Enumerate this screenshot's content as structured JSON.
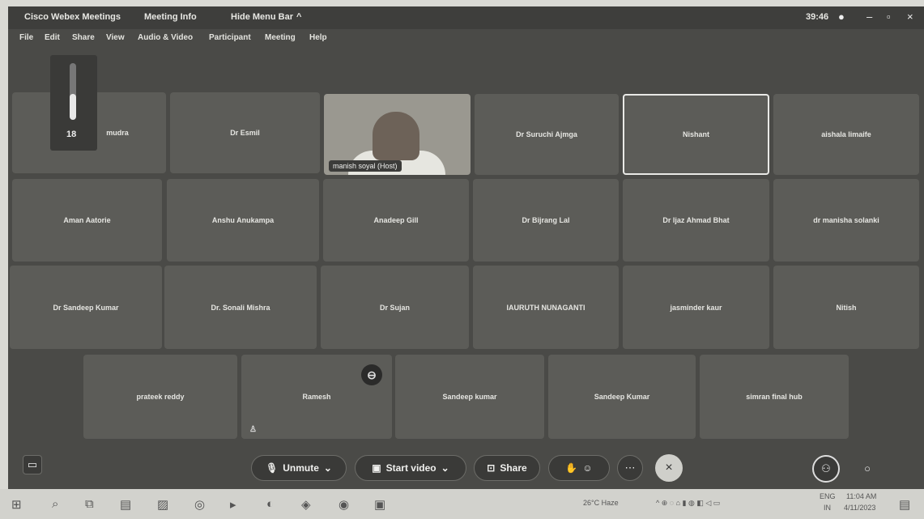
{
  "titlebar": {
    "app_name": "Cisco Webex Meetings",
    "meeting_info": "Meeting Info",
    "hide_menu": "Hide Menu Bar",
    "clock": "39:46"
  },
  "menu": [
    "File",
    "Edit",
    "Share",
    "View",
    "Audio & Video",
    "Participant",
    "Meeting",
    "Help"
  ],
  "volume": {
    "value": "18",
    "level": 0.45
  },
  "tiles_row1": [
    "mudra",
    "Dr Esmil",
    "manish soyal (Host)",
    "Dr Suruchi Ajmga",
    "Nishant",
    "aishala limaife"
  ],
  "tiles_row2": [
    "Aman Aatorie",
    "Anshu Anukampa",
    "Anadeep Gill",
    "Dr Bijrang Lal",
    "Dr Ijaz Ahmad Bhat",
    "dr manisha solanki"
  ],
  "tiles_row3": [
    "Dr Sandeep Kumar",
    "Dr. Sonali Mishra",
    "Dr Sujan",
    "IAURUTH NUNAGANTI",
    "jasminder kaur",
    "Nitish"
  ],
  "tiles_row4": [
    "prateek reddy",
    "Ramesh",
    "Sandeep kumar",
    "Sandeep Kumar",
    "simran final hub"
  ],
  "controls": {
    "unmute": "Unmute",
    "start_video": "Start video",
    "share": "Share"
  },
  "taskbar": {
    "weather": "26°C Haze",
    "lang": "ENG",
    "region": "IN",
    "time": "11:04 AM",
    "date": "4/11/2023"
  }
}
